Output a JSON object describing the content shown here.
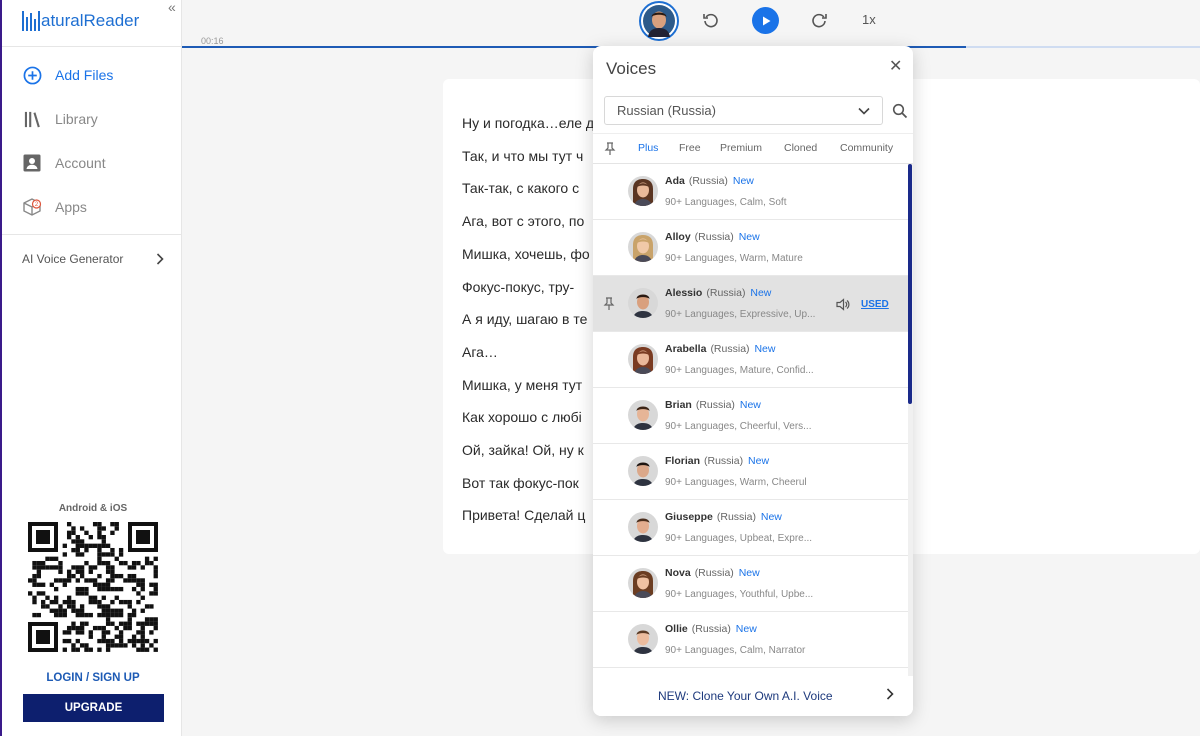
{
  "sidebar": {
    "logo": {
      "prefix": "N",
      "text": "aturalReader"
    },
    "collapse_icon": "«",
    "nav": [
      {
        "label": "Add Files",
        "icon": "plus-circle-icon",
        "active": true
      },
      {
        "label": "Library",
        "icon": "library-icon",
        "active": false
      },
      {
        "label": "Account",
        "icon": "account-icon",
        "active": false
      },
      {
        "label": "Apps",
        "icon": "apps-box-icon",
        "active": false
      }
    ],
    "ai_voice_generator": "AI Voice Generator",
    "android_ios": "Android & iOS",
    "login": "LOGIN / SIGN UP",
    "upgrade": "UPGRADE"
  },
  "player": {
    "time": "00:16",
    "speed": "1x",
    "progress": 0.77
  },
  "document": {
    "lines": [
      "Ну и погодка…еле д",
      "Так, и что мы тут ч",
      "Так-так, с какого с",
      "Ага, вот с этого, по",
      "Мишка, хочешь, фо",
      "Фокус-покус, тру-",
      "А я иду, шагаю в те",
      "Ага…",
      "Мишка, у меня тут",
      "Как хорошо с любі",
      "Ой, зайка! Ой, ну к",
      "Вот так фокус-пок",
      "Привета! Сделай ц"
    ]
  },
  "voices_panel": {
    "title": "Voices",
    "language": "Russian (Russia)",
    "tabs": [
      "Plus",
      "Free",
      "Premium",
      "Cloned",
      "Community"
    ],
    "active_tab": "Plus",
    "voices": [
      {
        "name": "Ada",
        "region": "(Russia)",
        "badge": "New",
        "desc": "90+ Languages, Calm, Soft",
        "gender": "female",
        "hair": "#5a3522",
        "skin": "#e8b99a"
      },
      {
        "name": "Alloy",
        "region": "(Russia)",
        "badge": "New",
        "desc": "90+ Languages, Warm, Mature",
        "gender": "female",
        "hair": "#c9a36a",
        "skin": "#f0c9a8"
      },
      {
        "name": "Alessio",
        "region": "(Russia)",
        "badge": "New",
        "desc": "90+ Languages, Expressive, Up...",
        "gender": "male",
        "hair": "#2a1a12",
        "skin": "#d9a07e",
        "selected": true,
        "used_label": "USED"
      },
      {
        "name": "Arabella",
        "region": "(Russia)",
        "badge": "New",
        "desc": "90+ Languages, Mature, Confid...",
        "gender": "female",
        "hair": "#7a3b22",
        "skin": "#ebb89a"
      },
      {
        "name": "Brian",
        "region": "(Russia)",
        "badge": "New",
        "desc": "90+ Languages, Cheerful, Vers...",
        "gender": "male",
        "hair": "#3b2416",
        "skin": "#e6b597"
      },
      {
        "name": "Florian",
        "region": "(Russia)",
        "badge": "New",
        "desc": "90+ Languages, Warm, Cheerul",
        "gender": "male",
        "hair": "#1e1612",
        "skin": "#dba88a"
      },
      {
        "name": "Giuseppe",
        "region": "(Russia)",
        "badge": "New",
        "desc": "90+ Languages, Upbeat, Expre...",
        "gender": "male",
        "hair": "#4a2e1d",
        "skin": "#e3ad8f"
      },
      {
        "name": "Nova",
        "region": "(Russia)",
        "badge": "New",
        "desc": "90+ Languages, Youthful, Upbe...",
        "gender": "female",
        "hair": "#6b3d22",
        "skin": "#efc1a2"
      },
      {
        "name": "Ollie",
        "region": "(Russia)",
        "badge": "New",
        "desc": "90+ Languages, Calm, Narrator",
        "gender": "male",
        "hair": "#5a3a24",
        "skin": "#ecbc9e"
      }
    ],
    "clone_cta": "NEW: Clone Your Own A.I. Voice"
  },
  "colors": {
    "accent": "#1a73e8",
    "upgrade_bg": "#0d1f6e",
    "scroll_thumb": "#1a2a8a"
  }
}
